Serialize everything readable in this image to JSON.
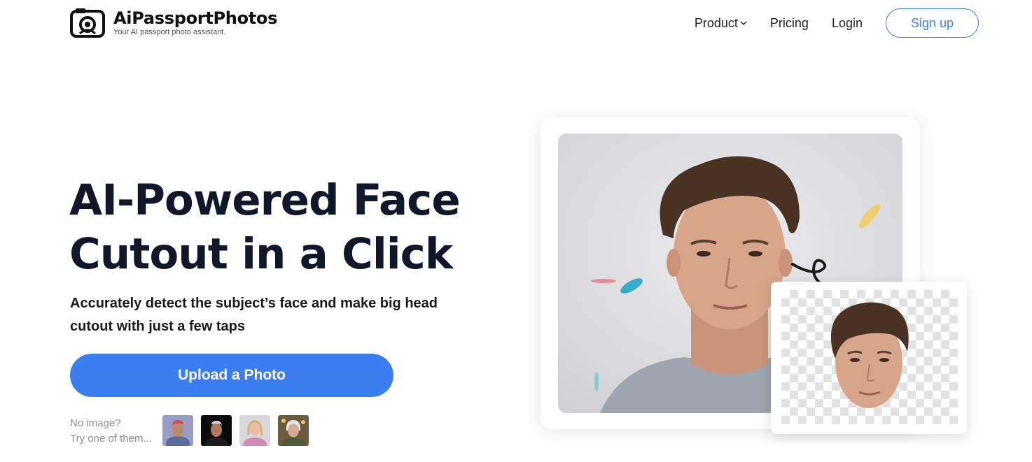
{
  "brand": {
    "name": "AiPassportPhotos",
    "tagline": "Your AI passport photo assistant."
  },
  "nav": {
    "product": "Product",
    "pricing": "Pricing",
    "login": "Login",
    "signup": "Sign up"
  },
  "hero": {
    "title_line1": "AI-Powered Face",
    "title_line2": "Cutout in a Click",
    "subtitle": "Accurately detect the subject’s face and make big head cutout with just a few taps",
    "upload_button": "Upload a Photo",
    "no_image_line1": "No image?",
    "no_image_line2": "Try one of them..."
  },
  "colors": {
    "accent": "#3b7ef2",
    "text_dark": "#0f1729",
    "muted": "#8a8f98"
  },
  "icons": {
    "logo": "camera-icon",
    "product_dropdown": "chevron-down-icon",
    "transform_arrow": "curly-arrow-icon"
  }
}
